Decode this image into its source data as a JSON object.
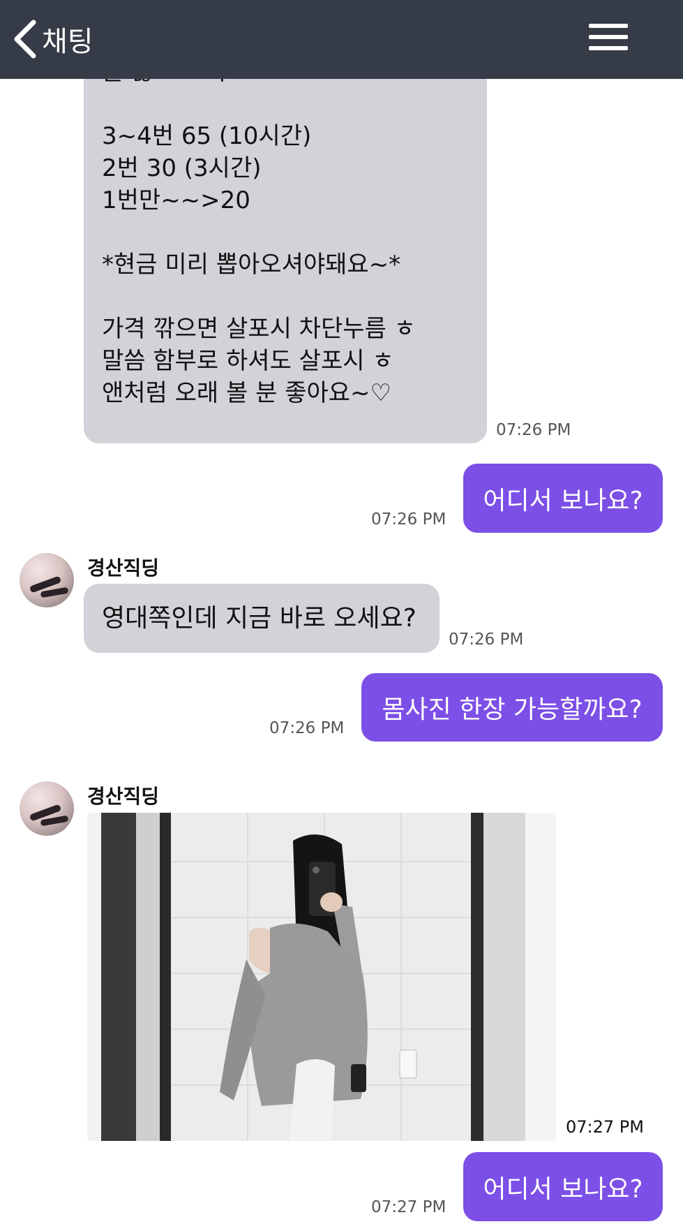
{
  "header": {
    "back_label": "채팅"
  },
  "messages": {
    "m1": {
      "lines": [
        "물 많고 쪼여요",
        "",
        "3~4번 65 (10시간)",
        "2번 30 (3시간)",
        "1번만~~>20",
        "",
        "*현금 미리 뽑아오셔야돼요~*",
        "",
        "가격 깎으면 살포시 차단누름 ㅎ",
        "말씀 함부로 하셔도 살포시 ㅎ",
        "앤처럼 오래 볼 분 좋아요~♡"
      ],
      "time": "07:26 PM"
    },
    "m2": {
      "text": "어디서 보나요?",
      "time": "07:26 PM"
    },
    "m3": {
      "sender": "경산직딩",
      "text": "영대쪽인데 지금 바로 오세요?",
      "time": "07:26 PM"
    },
    "m4": {
      "text": "몸사진 한장 가능할까요?",
      "time": "07:26 PM"
    },
    "m5": {
      "sender": "경산직딩",
      "time": "07:27 PM"
    },
    "m6": {
      "text": "어디서 보나요?",
      "time": "07:27 PM"
    }
  },
  "colors": {
    "header_bg": "#363c47",
    "outgoing_bubble": "#7c4fe6",
    "incoming_bubble": "#d1d3d8"
  }
}
